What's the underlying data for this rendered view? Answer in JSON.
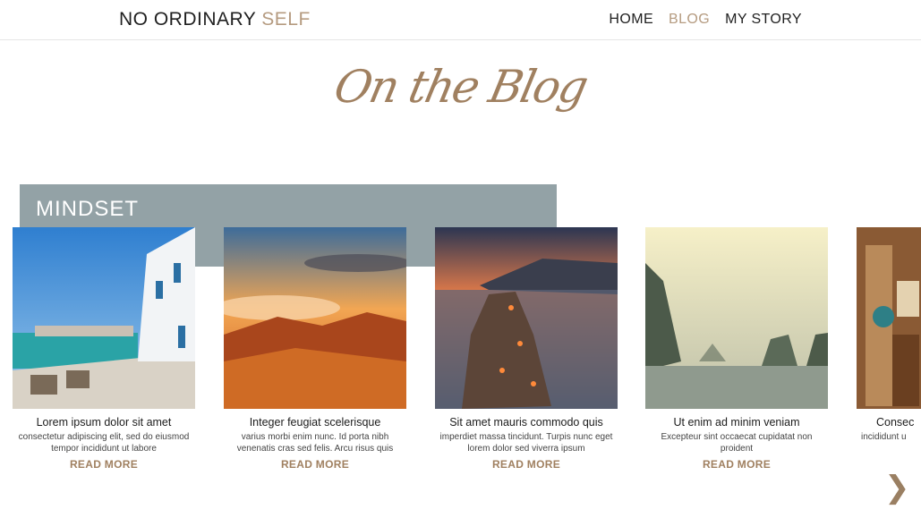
{
  "header": {
    "brand_main": "NO ORDINARY",
    "brand_accent": "SELF",
    "nav": [
      {
        "label": "HOME"
      },
      {
        "label": "BLOG"
      },
      {
        "label": "MY STORY"
      }
    ]
  },
  "section": {
    "title": "On the Blog",
    "category": "MINDSET"
  },
  "posts": [
    {
      "title": "Lorem ipsum dolor sit amet",
      "excerpt": "consectetur adipiscing elit, sed do eiusmod tempor incididunt ut labore",
      "cta": "READ MORE"
    },
    {
      "title": "Integer feugiat scelerisque",
      "excerpt": "varius morbi enim nunc. Id porta nibh venenatis cras sed felis. Arcu risus quis",
      "cta": "READ MORE"
    },
    {
      "title": "Sit amet mauris commodo quis",
      "excerpt": "imperdiet massa tincidunt. Turpis nunc eget lorem dolor sed viverra ipsum",
      "cta": "READ MORE"
    },
    {
      "title": "Ut enim ad minim veniam",
      "excerpt": "Excepteur sint occaecat cupidatat non proident",
      "cta": "READ MORE"
    },
    {
      "title": "Consec",
      "excerpt": "incididunt u",
      "cta": ""
    }
  ],
  "carousel": {
    "next_icon": "chevron-right-icon",
    "next_glyph": "❯"
  },
  "colors": {
    "accent": "#b59b80",
    "band": "#93a2a6"
  }
}
